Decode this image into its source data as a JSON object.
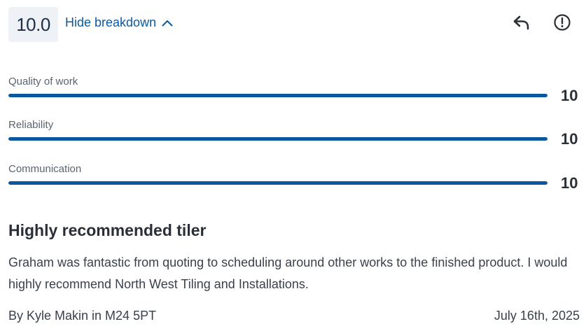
{
  "header": {
    "overall_score": "10.0",
    "toggle_label": "Hide breakdown",
    "reply_icon": "reply-icon",
    "report_icon": "exclamation-circle-icon"
  },
  "breakdown": [
    {
      "label": "Quality of work",
      "value": "10",
      "fraction": 1.0
    },
    {
      "label": "Reliability",
      "value": "10",
      "fraction": 1.0
    },
    {
      "label": "Communication",
      "value": "10",
      "fraction": 1.0
    }
  ],
  "review": {
    "title": "Highly recommended tiler",
    "text": "Graham was fantastic from quoting to scheduling around other works to the finished product. I would highly recommend North West Tiling and Installations.",
    "byline": "By Kyle Makin in M24 5PT",
    "date": "July 16th, 2025"
  },
  "colors": {
    "accent": "#0b5aa3",
    "bar": "#0b56a0",
    "badge_bg": "#eef1f5",
    "text": "#2a2f37"
  }
}
